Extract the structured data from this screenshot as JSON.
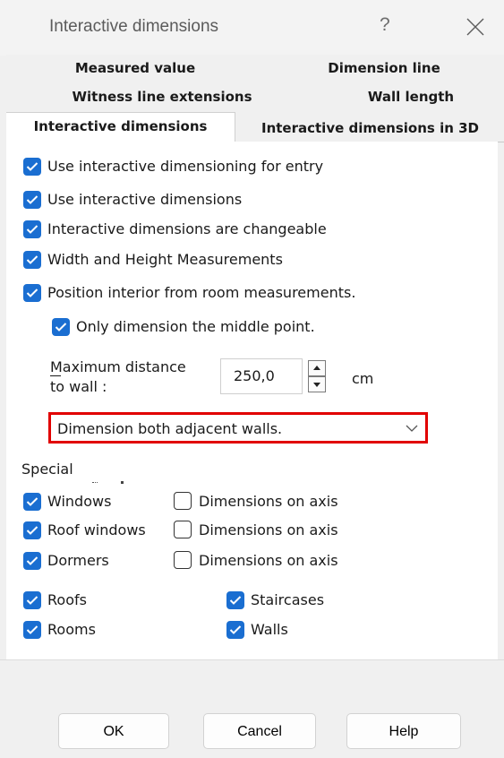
{
  "window": {
    "title": "Interactive dimensions",
    "help_glyph": "?",
    "close_icon": "close-icon"
  },
  "tabs": {
    "row1": [
      "Measured value",
      "Dimension line"
    ],
    "row2": [
      "Witness line extensions",
      "Wall length"
    ],
    "row3": [
      "Interactive dimensions",
      "Interactive dimensions in 3D"
    ],
    "active": "Interactive dimensions"
  },
  "options": [
    {
      "label": "Use interactive dimensioning for entry",
      "checked": true
    },
    {
      "label": "Use interactive dimensions",
      "checked": true
    },
    {
      "label": "Interactive dimensions are changeable",
      "checked": true
    },
    {
      "label": "Width and Height Measurements",
      "checked": true
    },
    {
      "label": "Position interior from room measurements.",
      "checked": true
    },
    {
      "label": "Only dimension the middle point.",
      "checked": true
    }
  ],
  "max_distance": {
    "label_line1": "Maximum distance",
    "label_line2": "to wall :",
    "mnemonic": "M",
    "value": "250,0",
    "unit": "cm"
  },
  "combo": {
    "selected": "Dimension both adjacent walls.",
    "highlight_color": "#e10000"
  },
  "special": {
    "heading": "Special",
    "items": [
      {
        "label": "Windows",
        "checked": true,
        "axis_label": "Dimensions on axis",
        "axis_checked": false
      },
      {
        "label": "Roof windows",
        "checked": true,
        "axis_label": "Dimensions on axis",
        "axis_checked": false
      },
      {
        "label": "Dormers",
        "checked": true,
        "axis_label": "Dimensions on axis",
        "axis_checked": false
      }
    ],
    "bottom_left": [
      {
        "label": "Roofs",
        "checked": true
      },
      {
        "label": "Rooms",
        "checked": true
      }
    ],
    "bottom_right": [
      {
        "label": "Staircases",
        "checked": true
      },
      {
        "label": "Walls",
        "checked": true
      }
    ]
  },
  "buttons": {
    "ok": "OK",
    "cancel": "Cancel",
    "help": "Help"
  },
  "colors": {
    "accent": "#1a6ed1",
    "highlight": "#e10000",
    "background": "#f0f0f0"
  }
}
